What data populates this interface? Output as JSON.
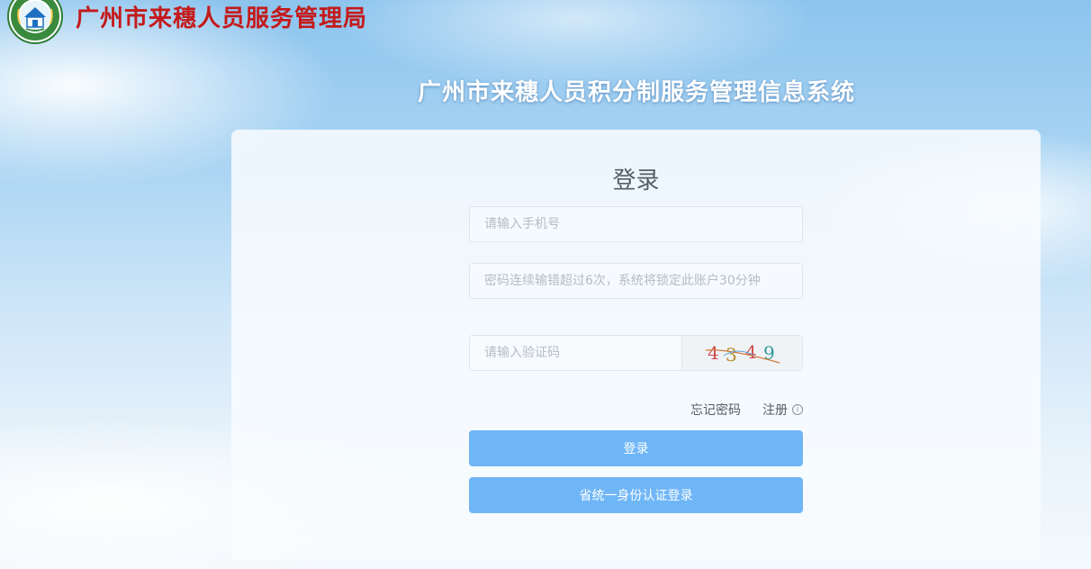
{
  "header": {
    "org_name": "广州市来穗人员服务管理局",
    "logo": "org-emblem"
  },
  "system_title": "广州市来穗人员积分制服务管理信息系统",
  "login": {
    "title": "登录",
    "phone_placeholder": "请输入手机号",
    "password_placeholder": "密码连续输错超过6次，系统将锁定此账户30分钟",
    "captcha_placeholder": "请输入验证码",
    "captcha_text": "4349",
    "forgot_password": "忘记密码",
    "register": "注册",
    "info_icon": "ⓘ",
    "login_button": "登录",
    "unified_login_button": "省统一身份认证登录"
  },
  "colors": {
    "org_name": "#c41a1a",
    "button": "#6fb6f7"
  }
}
